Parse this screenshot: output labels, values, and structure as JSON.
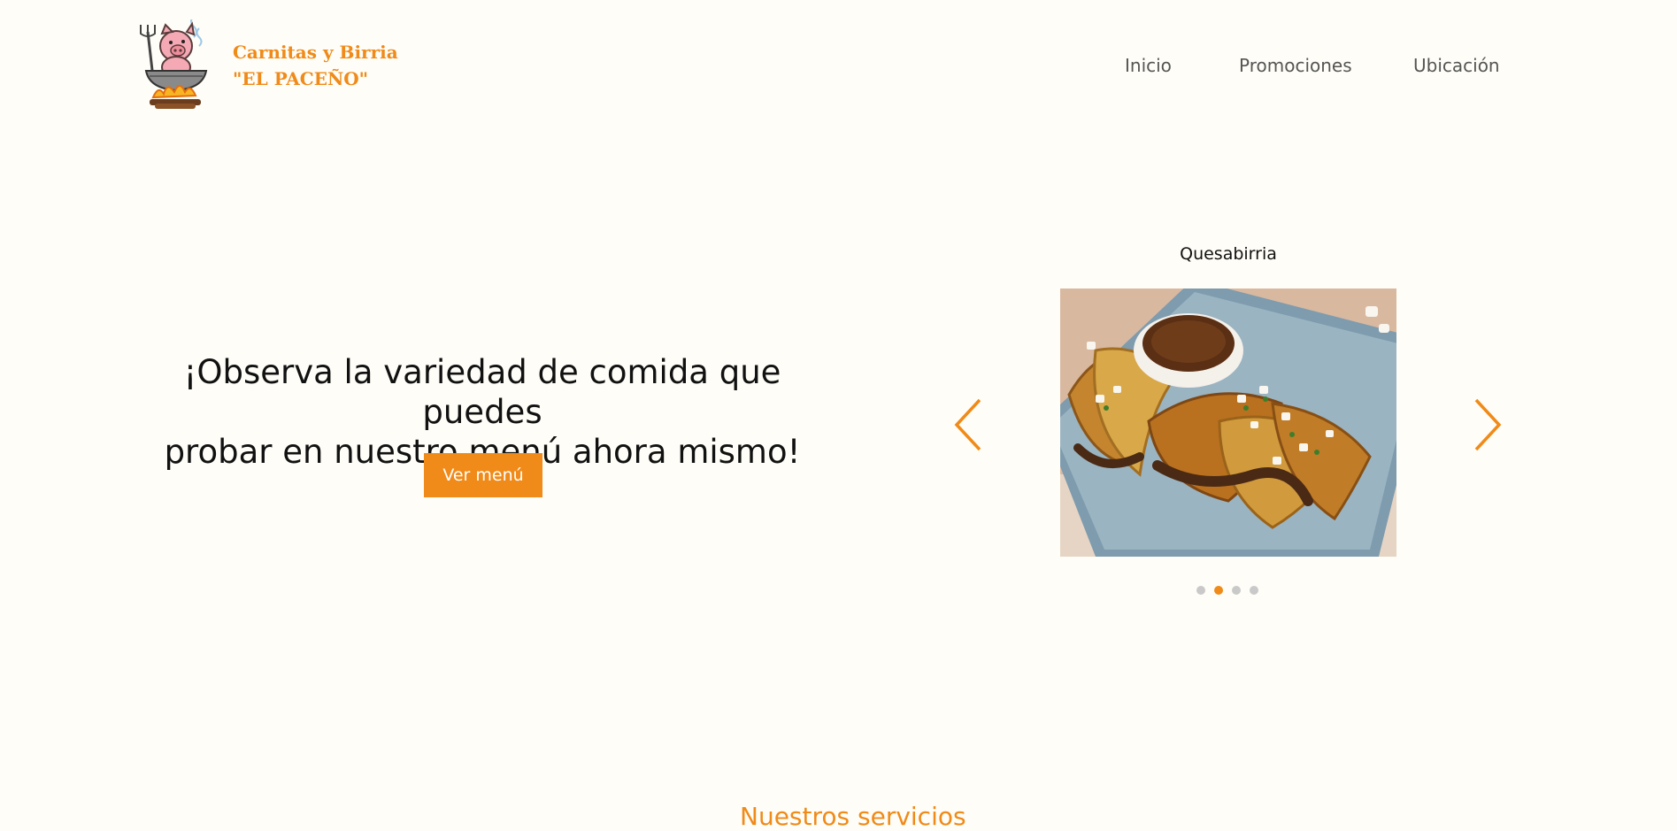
{
  "header": {
    "brand_line1": "Carnitas y Birria",
    "brand_line2": "\"EL PACEÑO\"",
    "logo_icon": "pig-in-pot-logo",
    "nav": {
      "items": [
        {
          "label": "Inicio"
        },
        {
          "label": "Promociones"
        },
        {
          "label": "Ubicación"
        }
      ]
    }
  },
  "hero": {
    "title_line1": "¡Observa la variedad de comida que puedes",
    "title_line2": "probar en nuestro menú ahora mismo!",
    "button_label": "Ver menú"
  },
  "carousel": {
    "caption": "Quesabirria",
    "image": "quesabirria-tacos-photo",
    "slide_count": 4,
    "active_index": 1,
    "prev_icon": "chevron-left-icon",
    "next_icon": "chevron-right-icon"
  },
  "next_section": {
    "title_partial": "Nuestros servicios"
  },
  "colors": {
    "accent": "#f08a18",
    "background": "#fefdf7",
    "nav_text": "#555555",
    "dot_inactive": "#c9c9c9"
  }
}
